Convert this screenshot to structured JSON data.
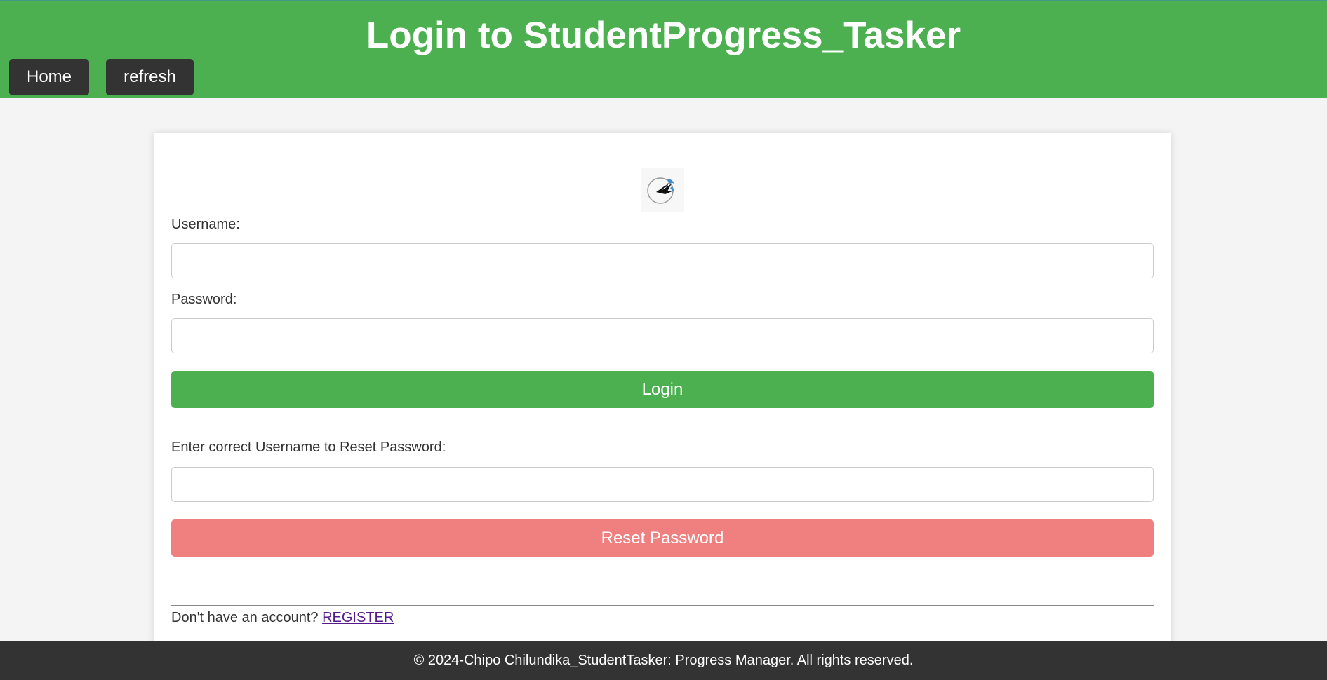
{
  "header": {
    "title": "Login to StudentProgress_Tasker",
    "accent_color": "#4caf50"
  },
  "nav": {
    "home_label": "Home",
    "refresh_label": "refresh"
  },
  "form": {
    "logo_icon": "swallow-bird-logo-icon",
    "username_label": "Username:",
    "username_value": "",
    "password_label": "Password:",
    "password_value": "",
    "login_label": "Login",
    "reset_label_text": "Enter correct Username to Reset Password:",
    "reset_username_value": "",
    "reset_button_label": "Reset Password",
    "reset_button_color": "#f08080",
    "register_prompt": "Don't have an account? ",
    "register_link": "REGISTER"
  },
  "footer": {
    "text": "© 2024-Chipo Chilundika_StudentTasker: Progress Manager. All rights reserved."
  }
}
